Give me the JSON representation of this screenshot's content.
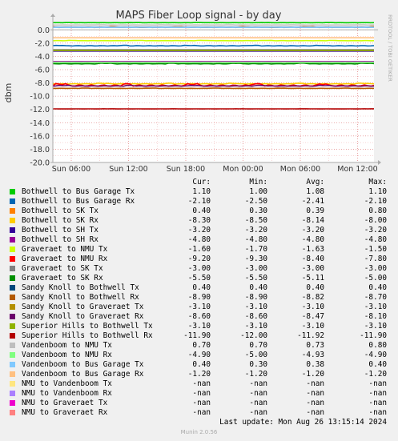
{
  "chart_data": {
    "type": "line",
    "title": "MAPS Fiber Loop signal - by day",
    "ylabel": "dbm",
    "ylim": [
      -20.0,
      1.0
    ],
    "y_ticks": [
      "0.0",
      "-2.0",
      "-4.0",
      "-6.0",
      "-8.0",
      "-10.0",
      "-12.0",
      "-14.0",
      "-16.0",
      "-18.0",
      "-20.0"
    ],
    "x_ticks": [
      "Sun 06:00",
      "Sun 12:00",
      "Sun 18:00",
      "Mon 00:00",
      "Mon 06:00",
      "Mon 12:00"
    ],
    "grid": true,
    "vertical_label": "RRDTOOL / TOBI OETIKER",
    "columns": [
      "Cur:",
      "Min:",
      "Avg:",
      "Max:"
    ],
    "series": [
      {
        "name": "Bothwell to Bus Garage Tx",
        "color": "#00cc00",
        "cur": "1.10",
        "min": "1.00",
        "avg": "1.08",
        "max": "1.10",
        "level": 1.08
      },
      {
        "name": "Bothwell to Bus Garage Rx",
        "color": "#0066b3",
        "cur": "-2.10",
        "min": "-2.50",
        "avg": "-2.41",
        "max": "-2.10",
        "level": -2.41
      },
      {
        "name": "Bothwell to SK Tx",
        "color": "#ff8000",
        "cur": "0.40",
        "min": "0.30",
        "avg": "0.39",
        "max": "0.80",
        "level": 0.39
      },
      {
        "name": "Bothwell to SK Rx",
        "color": "#ffcc00",
        "cur": "-8.30",
        "min": "-8.50",
        "avg": "-8.14",
        "max": "-8.00",
        "level": -8.14
      },
      {
        "name": "Bothwell to SH Tx",
        "color": "#330099",
        "cur": "-3.20",
        "min": "-3.20",
        "avg": "-3.20",
        "max": "-3.20",
        "level": -3.2
      },
      {
        "name": "Bothwell to SH Rx",
        "color": "#990099",
        "cur": "-4.80",
        "min": "-4.80",
        "avg": "-4.80",
        "max": "-4.80",
        "level": -4.8
      },
      {
        "name": "Graveraet to NMU Tx",
        "color": "#ccff00",
        "cur": "-1.60",
        "min": "-1.70",
        "avg": "-1.63",
        "max": "-1.50",
        "level": -1.63
      },
      {
        "name": "Graveraet to NMU Rx",
        "color": "#ff0000",
        "cur": "-9.20",
        "min": "-9.30",
        "avg": "-8.40",
        "max": "-7.80",
        "level": -8.4
      },
      {
        "name": "Graveraet to SK Tx",
        "color": "#808080",
        "cur": "-3.00",
        "min": "-3.00",
        "avg": "-3.00",
        "max": "-3.00",
        "level": -3.0
      },
      {
        "name": "Graveraet to SK Rx",
        "color": "#008f00",
        "cur": "-5.50",
        "min": "-5.50",
        "avg": "-5.11",
        "max": "-5.00",
        "level": -5.11
      },
      {
        "name": "Sandy Knoll to Bothwell Tx",
        "color": "#00487d",
        "cur": "0.40",
        "min": "0.40",
        "avg": "0.40",
        "max": "0.40",
        "level": 0.4
      },
      {
        "name": "Sandy Knoll to Bothwell Rx",
        "color": "#b35a00",
        "cur": "-8.90",
        "min": "-8.90",
        "avg": "-8.82",
        "max": "-8.70",
        "level": -8.82
      },
      {
        "name": "Sandy Knoll to Graveraet Tx",
        "color": "#b38f00",
        "cur": "-3.10",
        "min": "-3.10",
        "avg": "-3.10",
        "max": "-3.10",
        "level": -3.1
      },
      {
        "name": "Sandy Knoll to Graveraet Rx",
        "color": "#6b006b",
        "cur": "-8.60",
        "min": "-8.60",
        "avg": "-8.47",
        "max": "-8.10",
        "level": -8.47
      },
      {
        "name": "Superior Hills to Bothwell Tx",
        "color": "#8fb300",
        "cur": "-3.10",
        "min": "-3.10",
        "avg": "-3.10",
        "max": "-3.10",
        "level": -3.1
      },
      {
        "name": "Superior Hills to Bothwell Rx",
        "color": "#b30000",
        "cur": "-11.90",
        "min": "-12.00",
        "avg": "-11.92",
        "max": "-11.90",
        "level": -11.92
      },
      {
        "name": "Vandenboom to NMU Tx",
        "color": "#bebebe",
        "cur": "0.70",
        "min": "0.70",
        "avg": "0.73",
        "max": "0.80",
        "level": 0.73
      },
      {
        "name": "Vandenboom to NMU Rx",
        "color": "#80ff80",
        "cur": "-4.90",
        "min": "-5.00",
        "avg": "-4.93",
        "max": "-4.90",
        "level": -4.93
      },
      {
        "name": "Vandenboom to Bus Garage Tx",
        "color": "#80c9ff",
        "cur": "0.40",
        "min": "0.30",
        "avg": "0.38",
        "max": "0.40",
        "level": 0.38
      },
      {
        "name": "Vandenboom to Bus Garage Rx",
        "color": "#ffc080",
        "cur": "-1.20",
        "min": "-1.20",
        "avg": "-1.20",
        "max": "-1.20",
        "level": -1.2
      },
      {
        "name": "NMU to Vandenboom Tx",
        "color": "#ffe680",
        "cur": "-nan",
        "min": "-nan",
        "avg": "-nan",
        "max": "-nan",
        "level": null
      },
      {
        "name": "NMU to Vandenboom Rx",
        "color": "#aa80ff",
        "cur": "-nan",
        "min": "-nan",
        "avg": "-nan",
        "max": "-nan",
        "level": null
      },
      {
        "name": "NMU to Graveraet Tx",
        "color": "#ee00cc",
        "cur": "-nan",
        "min": "-nan",
        "avg": "-nan",
        "max": "-nan",
        "level": null
      },
      {
        "name": "NMU to Graveraet Rx",
        "color": "#ff8080",
        "cur": "-nan",
        "min": "-nan",
        "avg": "-nan",
        "max": "-nan",
        "level": null
      }
    ]
  },
  "footer": {
    "last_update": "Last update: Mon Aug 26 13:15:14 2024",
    "munin": "Munin 2.0.56"
  }
}
